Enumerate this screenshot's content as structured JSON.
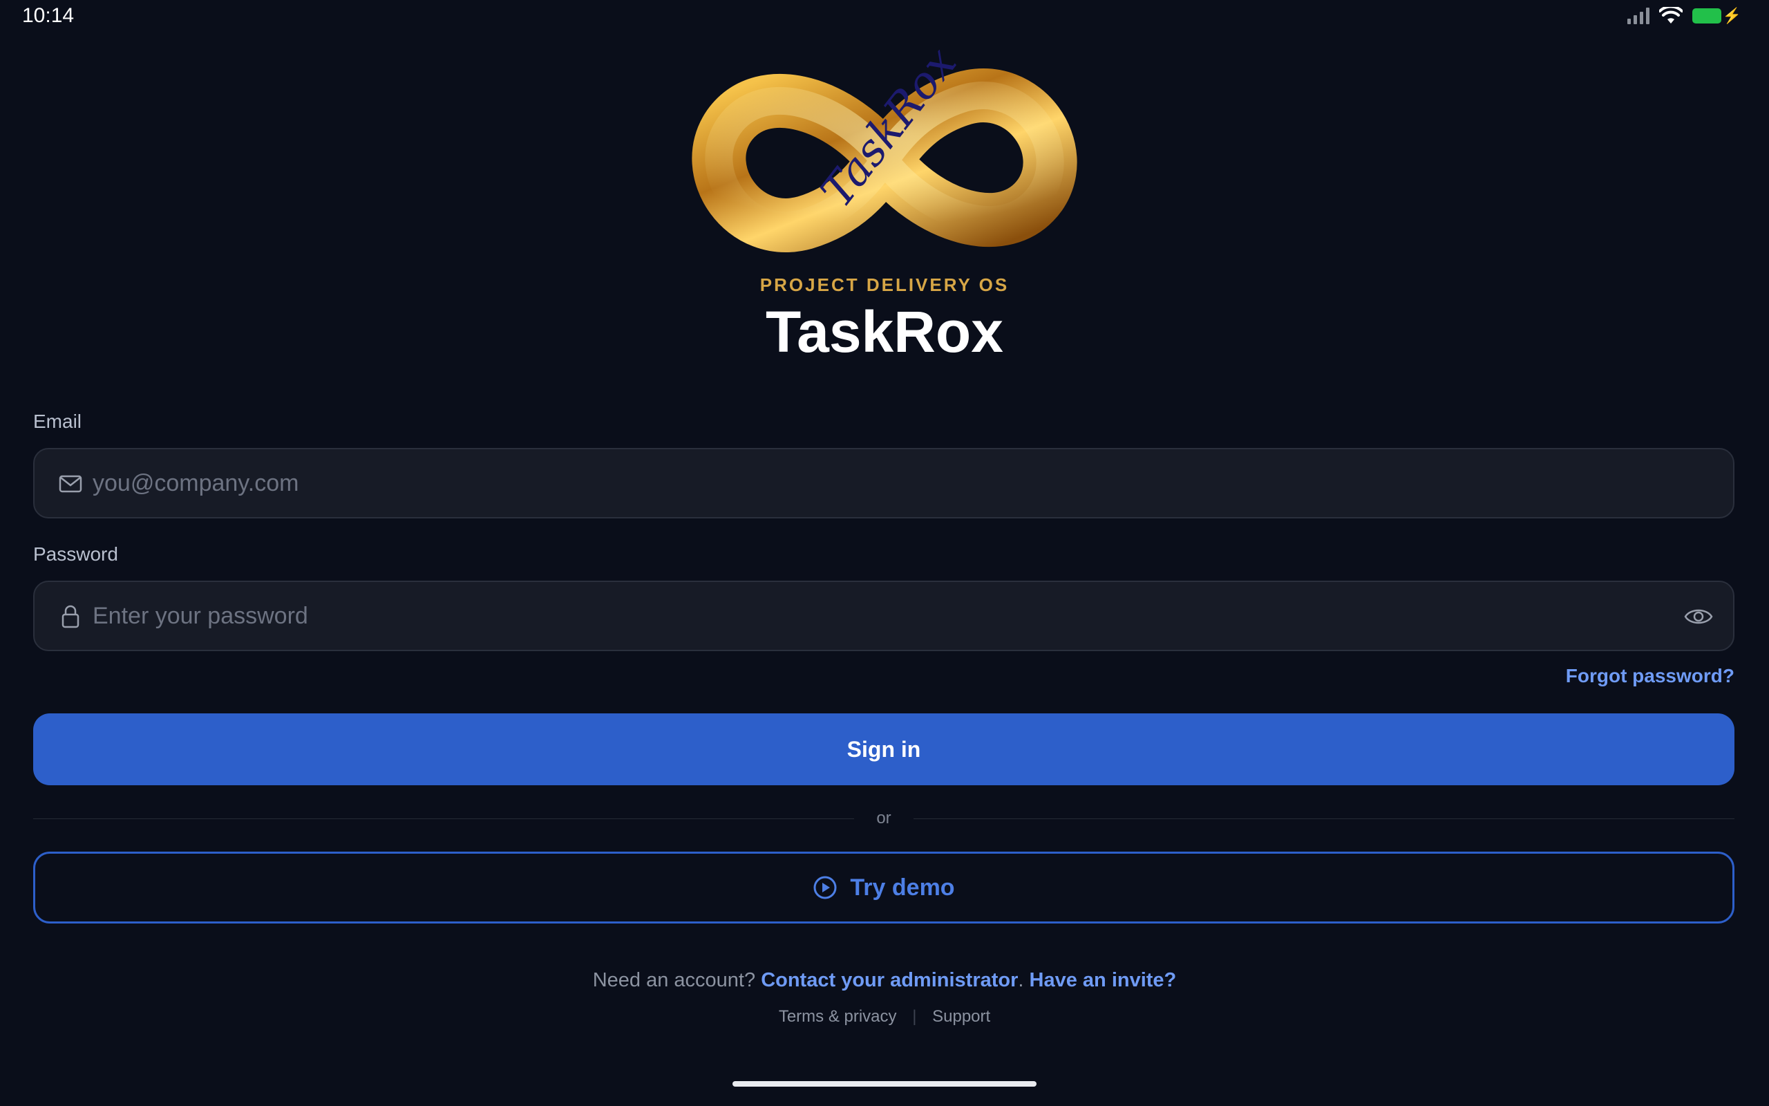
{
  "status_bar": {
    "time": "10:14"
  },
  "logo": {
    "wordmark": "TaskRox"
  },
  "header": {
    "kicker": "PROJECT DELIVERY OS",
    "title": "TaskRox"
  },
  "form": {
    "email": {
      "label": "Email",
      "placeholder": "you@company.com",
      "value": ""
    },
    "password": {
      "label": "Password",
      "placeholder": "Enter your password",
      "value": ""
    },
    "forgot_label": "Forgot password?",
    "submit_label": "Sign in",
    "divider_label": "or",
    "demo_label": "Try demo"
  },
  "account": {
    "prompt": "Need an account?",
    "contact_label": "Contact your administrator",
    "punct": ".",
    "invite_label": "Have an invite?"
  },
  "footer": {
    "terms_label": "Terms & privacy",
    "separator": "|",
    "support_label": "Support"
  },
  "colors": {
    "background": "#0a0e1a",
    "accent": "#2d5fca",
    "link": "#6f9bf5",
    "kicker": "#d7a646",
    "battery": "#22c04a"
  }
}
